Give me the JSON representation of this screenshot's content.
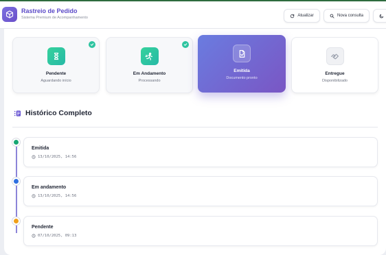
{
  "header": {
    "title": "Rastreio de Pedido",
    "subtitle": "Sistema Premium de Acompanhamento",
    "refresh_label": "Atualizar",
    "new_query_label": "Nova consulta"
  },
  "steps": [
    {
      "title": "Pendente",
      "subtitle": "Aguardando início",
      "icon": "hourglass-icon",
      "completed": true
    },
    {
      "title": "Em Andamento",
      "subtitle": "Processando",
      "icon": "running-person-icon",
      "completed": true
    },
    {
      "title": "Emitida",
      "subtitle": "Documento pronto",
      "icon": "document-check-icon",
      "current": true
    },
    {
      "title": "Entregue",
      "subtitle": "Disponibilizado",
      "icon": "handshake-icon",
      "completed": false
    }
  ],
  "history": {
    "title": "Histórico Completo",
    "events": [
      {
        "status": "Emitida",
        "time": "13/10/2025, 14:56",
        "color": "#17a673"
      },
      {
        "status": "Em andamento",
        "time": "13/10/2025, 14:56",
        "color": "#2f6fe0"
      },
      {
        "status": "Pendente",
        "time": "07/10/2025, 09:13",
        "color": "#f0a01a"
      }
    ]
  },
  "colors": {
    "brand": "#5a49c7",
    "accent_gradient_start": "#6a7ce0",
    "accent_gradient_end": "#7a56c4",
    "success": "#2ec4a0"
  }
}
